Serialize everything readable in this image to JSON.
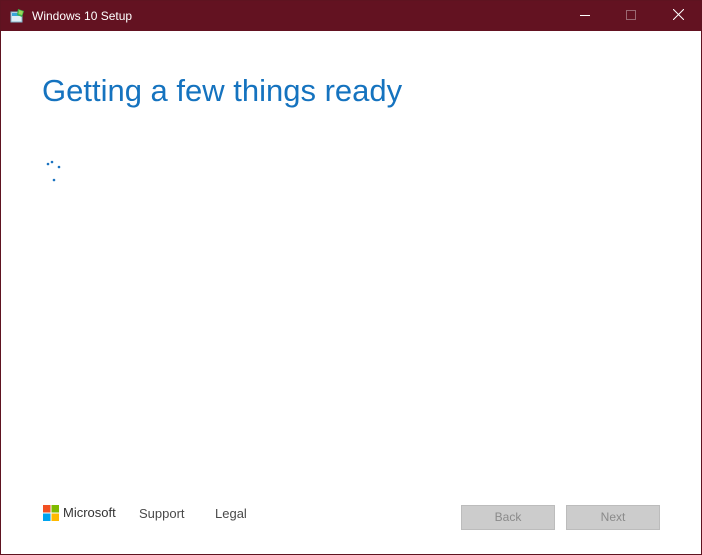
{
  "window": {
    "title": "Windows 10 Setup",
    "title_icon": "setup-app-icon",
    "titlebar_color": "#631221",
    "controls": {
      "minimize_icon": "minimize-icon",
      "maximize_icon": "maximize-icon",
      "close_icon": "close-icon"
    }
  },
  "main": {
    "heading": "Getting a few things ready",
    "heading_color": "#1573bf",
    "status_indicator": "loading-spinner-icon"
  },
  "footer": {
    "brand": "Microsoft",
    "brand_logo": "microsoft-logo-icon",
    "links": {
      "support": "Support",
      "legal": "Legal"
    },
    "buttons": {
      "back": "Back",
      "next": "Next",
      "back_enabled": false,
      "next_enabled": false
    }
  }
}
